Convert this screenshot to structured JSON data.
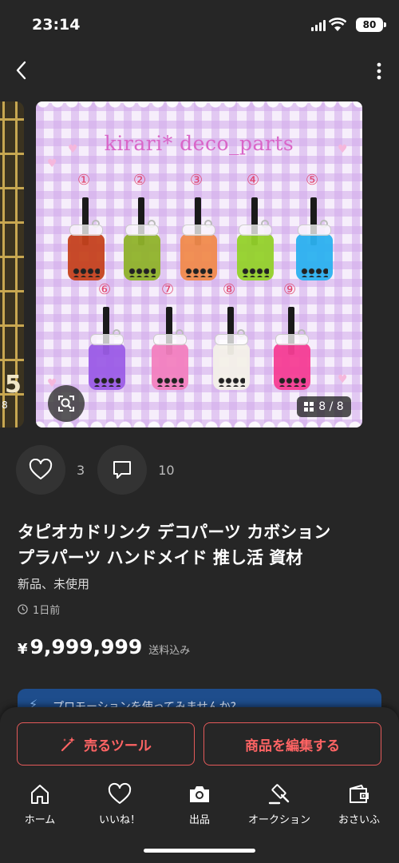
{
  "status": {
    "time": "23:14",
    "battery": "80"
  },
  "product": {
    "image_brand_text": "kirari* deco_parts",
    "variant_numbers": [
      "①",
      "②",
      "③",
      "④",
      "⑤",
      "⑥",
      "⑦",
      "⑧",
      "⑨"
    ],
    "drink_colors": [
      "#c5421e",
      "#8fb22a",
      "#f08a4c",
      "#93d12a",
      "#2bb1ef",
      "#9b5ce6",
      "#f27fbf",
      "#f3f0e8",
      "#f53d93"
    ],
    "image_counter": "8 / 8",
    "prev_image_numeral": "5",
    "prev_image_small": "8",
    "likes": "3",
    "comments": "10",
    "title_line1": "タピオカドリンク デコパーツ カボション",
    "title_line2": "プラパーツ ハンドメイド 推し活 資材",
    "condition": "新品、未使用",
    "posted": "1日前",
    "price_symbol": "¥",
    "price": "9,999,999",
    "price_note": "送料込み"
  },
  "promo": {
    "text": "プロモーションを使ってみませんか?"
  },
  "buttons": {
    "sell_tool": "売るツール",
    "edit_item": "商品を編集する"
  },
  "tabs": [
    {
      "label": "ホーム",
      "icon": "home-icon"
    },
    {
      "label": "いいね！",
      "icon": "heart-icon"
    },
    {
      "label": "出品",
      "icon": "camera-icon"
    },
    {
      "label": "オークション",
      "icon": "gavel-icon"
    },
    {
      "label": "おさいふ",
      "icon": "wallet-icon"
    }
  ],
  "colors": {
    "accent": "#ff6464",
    "promo_bg": "#1e4d8c",
    "background": "#262626"
  }
}
